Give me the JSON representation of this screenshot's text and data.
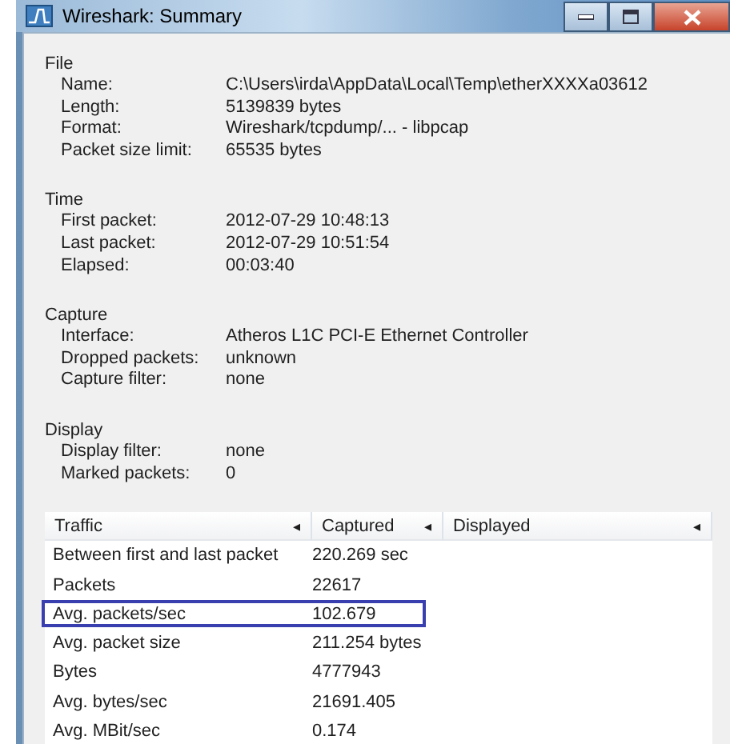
{
  "window": {
    "title": "Wireshark: Summary"
  },
  "sections": [
    {
      "heading": "File",
      "fields": [
        {
          "label": "Name:",
          "value": "C:\\Users\\irda\\AppData\\Local\\Temp\\etherXXXXa03612"
        },
        {
          "label": "Length:",
          "value": "5139839 bytes"
        },
        {
          "label": "Format:",
          "value": "Wireshark/tcpdump/... - libpcap"
        },
        {
          "label": "Packet size limit:",
          "value": "65535 bytes"
        }
      ]
    },
    {
      "heading": "Time",
      "fields": [
        {
          "label": "First packet:",
          "value": "2012-07-29 10:48:13"
        },
        {
          "label": "Last packet:",
          "value": "2012-07-29 10:51:54"
        },
        {
          "label": "Elapsed:",
          "value": "00:03:40"
        }
      ]
    },
    {
      "heading": "Capture",
      "fields": [
        {
          "label": "Interface:",
          "value": "Atheros L1C PCI-E Ethernet Controller"
        },
        {
          "label": "Dropped packets:",
          "value": "unknown"
        },
        {
          "label": "Capture filter:",
          "value": "none"
        }
      ]
    },
    {
      "heading": "Display",
      "fields": [
        {
          "label": "Display filter:",
          "value": "none"
        },
        {
          "label": "Marked packets:",
          "value": "0"
        }
      ]
    }
  ],
  "table": {
    "columns": [
      {
        "label": "Traffic",
        "sort_arrow": "◂"
      },
      {
        "label": "Captured",
        "sort_arrow": "◂"
      },
      {
        "label": "Displayed",
        "sort_arrow": "◂"
      }
    ],
    "rows": [
      {
        "cells": [
          "Between first and last packet",
          "220.269 sec"
        ],
        "highlighted": false
      },
      {
        "cells": [
          "Packets",
          "22617"
        ],
        "highlighted": false
      },
      {
        "cells": [
          "Avg. packets/sec",
          "102.679"
        ],
        "highlighted": true
      },
      {
        "cells": [
          "Avg. packet size",
          "211.254 bytes"
        ],
        "highlighted": false
      },
      {
        "cells": [
          "Bytes",
          "4777943"
        ],
        "highlighted": false
      },
      {
        "cells": [
          "Avg. bytes/sec",
          "21691.405"
        ],
        "highlighted": false
      },
      {
        "cells": [
          "Avg. MBit/sec",
          "0.174"
        ],
        "highlighted": false
      }
    ]
  }
}
